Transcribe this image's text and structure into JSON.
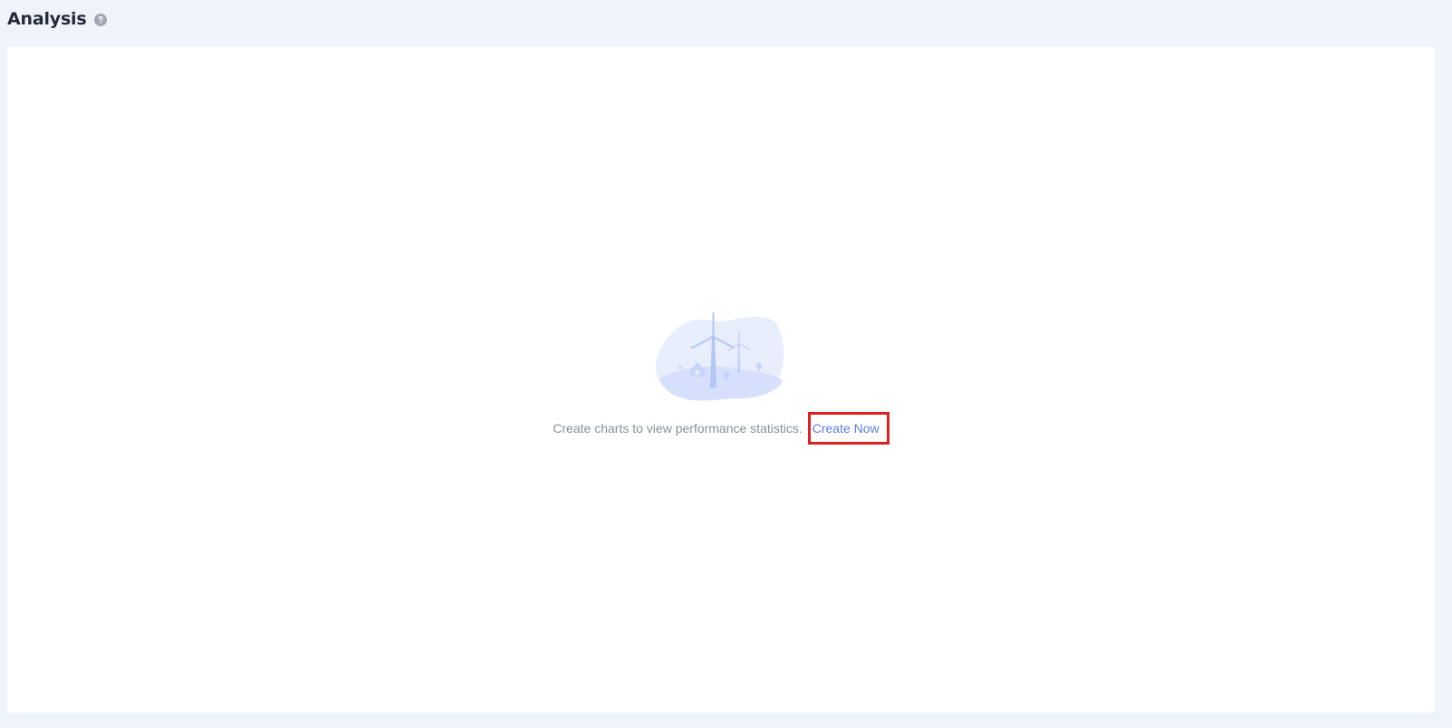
{
  "header": {
    "title": "Analysis",
    "help_icon": "question-circle-icon"
  },
  "empty_state": {
    "illustration": "wind-turbine-illustration",
    "message": "Create charts to view performance statistics.",
    "action_label": "Create Now"
  },
  "colors": {
    "page_background": "#eff3fa",
    "panel_background": "#ffffff",
    "title_text": "#252b3a",
    "muted_text": "#8a8e99",
    "link": "#5e7ce0",
    "highlight_border": "#e02020",
    "illustration": "#c9d6fb"
  }
}
